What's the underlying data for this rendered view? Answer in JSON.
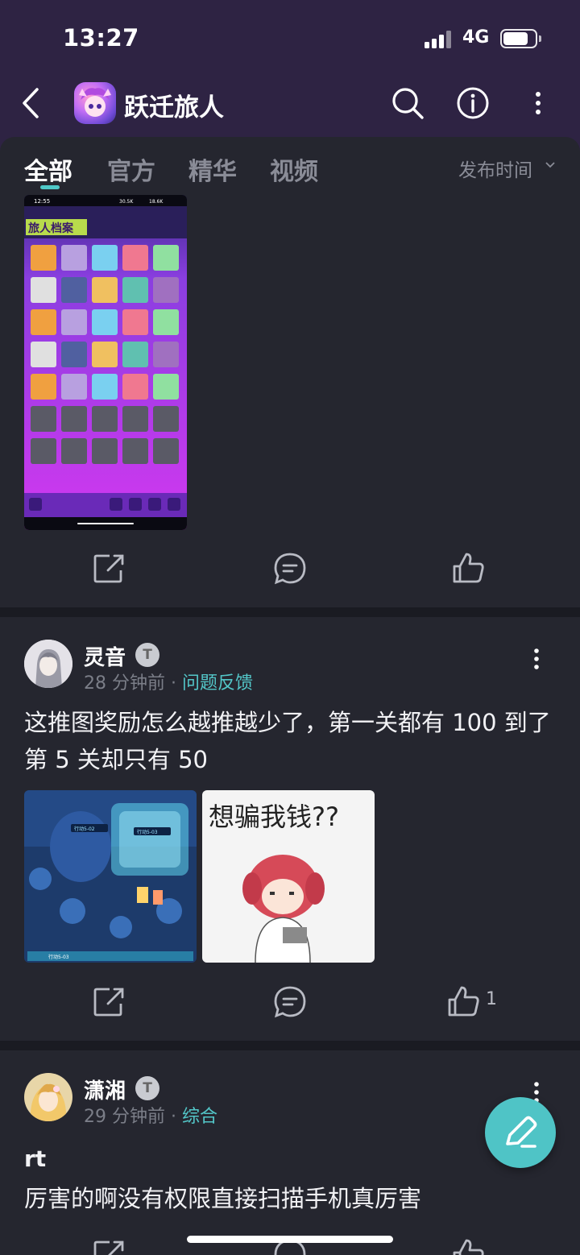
{
  "status_bar": {
    "time": "13:27",
    "network": "4G"
  },
  "nav": {
    "title": "跃迁旅人"
  },
  "tabs": {
    "items": [
      {
        "label": "全部",
        "active": true
      },
      {
        "label": "官方",
        "active": false
      },
      {
        "label": "精华",
        "active": false
      },
      {
        "label": "视频",
        "active": false
      }
    ],
    "sort_label": "发布时间"
  },
  "post1": {
    "image": {
      "title": "旅人档案",
      "time": "12:55",
      "stat_a": "30.5K",
      "stat_b": "18.6K"
    }
  },
  "post2": {
    "author": "灵音",
    "badge": "T",
    "time": "28 分钟前",
    "dot": "·",
    "category": "问题反馈",
    "text": "这推图奖励怎么越推越少了，第一关都有 100 到了第 5 关却只有 50",
    "image_a_labels": [
      "行动5-03",
      "行动5-02",
      "行动5-03"
    ],
    "image_b_caption": "想骗我钱??",
    "like_count": "1"
  },
  "post3": {
    "author": "潇湘",
    "badge": "T",
    "time": "29 分钟前",
    "dot": "·",
    "category": "综合",
    "title": "rt",
    "text": "厉害的啊没有权限直接扫描手机真厉害"
  },
  "colors": {
    "accent": "#4fc4c6",
    "header": "#2e2343",
    "background": "#25262f"
  },
  "icons": [
    "back-icon",
    "search-icon",
    "info-icon",
    "more-icon",
    "share-icon",
    "comment-icon",
    "like-icon",
    "pen-icon"
  ]
}
